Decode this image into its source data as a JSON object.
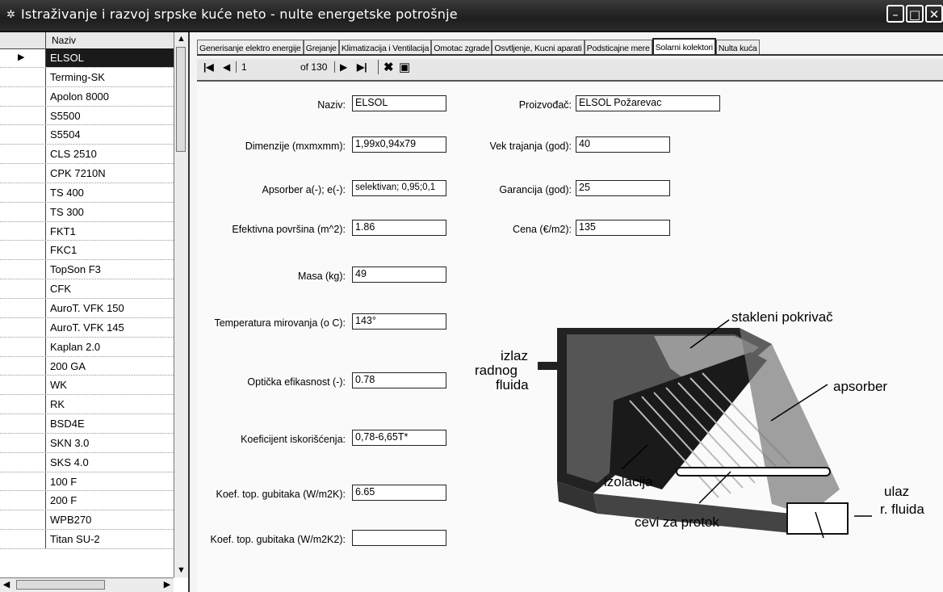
{
  "window": {
    "title": "Istraživanje i razvoj srpske kuće neto - nulte energetske potrošnje",
    "min_icon": "minimize-icon",
    "max_icon": "maximize-icon",
    "close_icon": "close-icon"
  },
  "grid": {
    "header": "Naziv",
    "rows": [
      "ELSOL",
      "Terming-SK",
      "Apolon 8000",
      "S5500",
      "S5504",
      "CLS 2510",
      "CPK 7210N",
      "TS 400",
      "TS 300",
      "FKT1",
      "FKC1",
      "TopSon F3",
      "CFK",
      "AuroT. VFK 150",
      "AuroT. VFK 145",
      "Kaplan 2.0",
      "200 GA",
      "WK",
      "RK",
      "BSD4E",
      "SKN 3.0",
      "SKS 4.0",
      "100 F",
      "200 F",
      "WPB270",
      "Titan SU-2"
    ],
    "selected_index": 0
  },
  "tabs": [
    "Generisanje elektro energije",
    "Grejanje",
    "Klimatizacija i Ventilacija",
    "Omotac zgrade",
    "Osvtljenje, Kucni aparati",
    "Podsticajne mere",
    "Solarni kolektori",
    "Nulta kuća"
  ],
  "active_tab": 6,
  "navigator": {
    "position": "1",
    "of_total": "of 130"
  },
  "form": {
    "naziv_label": "Naziv:",
    "naziv_value": "ELSOL",
    "proizvodjac_label": "Proizvođač:",
    "proizvodjac_value": "ELSOL Požarevac",
    "dimenzije_label": "Dimenzije (mxmxmm):",
    "dimenzije_value": "1,99x0,94x79",
    "vek_label": "Vek trajanja (god):",
    "vek_value": "40",
    "apsorber_label": "Apsorber a(-); e(-):",
    "apsorber_value": "selektivan; 0,95;0,1",
    "garancija_label": "Garancija (god):",
    "garancija_value": "25",
    "povrsina_label": "Efektivna površina (m^2):",
    "povrsina_value": "1.86",
    "cena_label": "Cena (€/m2):",
    "cena_value": "135",
    "masa_label": "Masa (kg):",
    "masa_value": "49",
    "temp_label": "Temperatura mirovanja (o C):",
    "temp_value": "143°",
    "opticka_label": "Optička efikasnost (-):",
    "opticka_value": "0.78",
    "koef_isk_label": "Koeficijent iskorišćenja:",
    "koef_isk_value": "0,78-6,65T*",
    "koef_gub_label": "Koef. top. gubitaka (W/m2K):",
    "koef_gub_value": "6.65",
    "koef_gub2_label": "Koef. top. gubitaka (W/m2K2):",
    "koef_gub2_value": ""
  },
  "diagram": {
    "stakleni": "stakleni pokrivač",
    "izlaz1": "izlaz",
    "izlaz2": "radnog",
    "izlaz3": "fluida",
    "apsorber": "apsorber",
    "izolacija": "izolacija",
    "cevi": "cevi za protok",
    "ulaz1": "ulaz",
    "ulaz2": "r. fluida"
  }
}
